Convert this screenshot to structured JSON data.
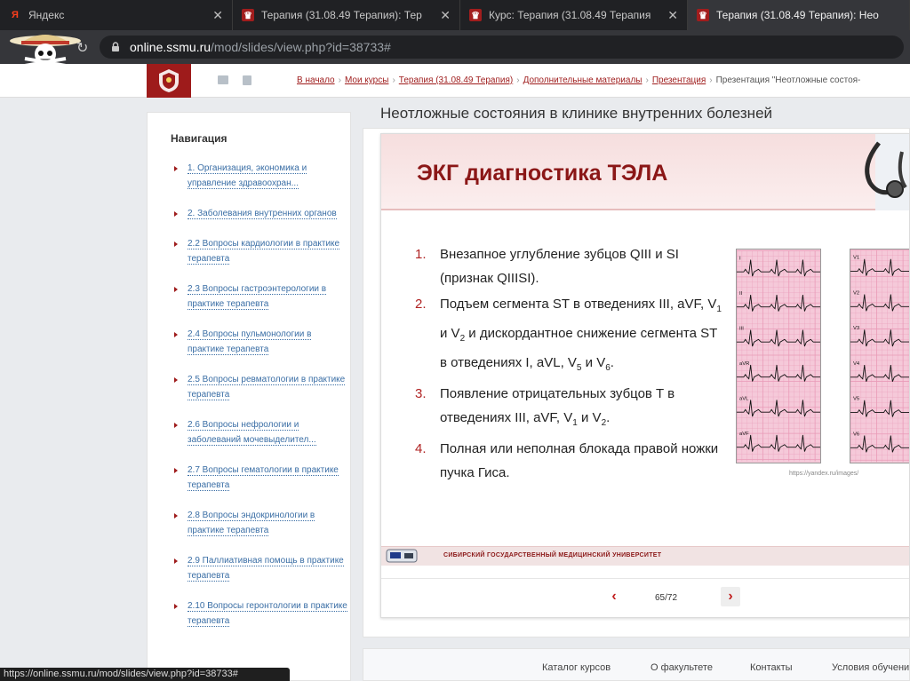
{
  "browser": {
    "tabs": [
      {
        "title": "Яндекс",
        "favicon": "yandex-icon"
      },
      {
        "title": "Терапия (31.08.49 Терапия): Тер",
        "favicon": "ssmu-crest-icon"
      },
      {
        "title": "Курс: Терапия (31.08.49 Терапия",
        "favicon": "ssmu-crest-icon"
      },
      {
        "title": "Терапия (31.08.49 Терапия): Нео",
        "favicon": "ssmu-crest-icon"
      }
    ],
    "url_host": "online.ssmu.ru",
    "url_path": "/mod/slides/view.php?id=38733#"
  },
  "header": {
    "breadcrumb": [
      {
        "label": "В начало",
        "link": true
      },
      {
        "label": "Мои курсы",
        "link": true
      },
      {
        "label": "Терапия (31.08.49 Терапия)",
        "link": true
      },
      {
        "label": "Дополнительные материалы",
        "link": true
      },
      {
        "label": "Презентация",
        "link": true
      },
      {
        "label": "Презентация \"Неотложные состоя-",
        "link": false
      }
    ]
  },
  "sidebar": {
    "heading": "Навигация",
    "items": [
      {
        "label": "1. Организация, экономика и управление здравоохран..."
      },
      {
        "label": "2. Заболевания внутренних органов"
      },
      {
        "label": "2.2 Вопросы кардиологии в практике терапевта"
      },
      {
        "label": "2.3 Вопросы гастроэнтерологии в практике терапевта"
      },
      {
        "label": "2.4 Вопросы пульмонологии в практике терапевта"
      },
      {
        "label": "2.5 Вопросы ревматологии в практике терапевта"
      },
      {
        "label": "2.6 Вопросы нефрологии и заболеваний мочевыделител..."
      },
      {
        "label": "2.7 Вопросы гематологии в практике терапевта"
      },
      {
        "label": "2.8 Вопросы эндокринологии в практике терапевта"
      },
      {
        "label": "2.9 Паллиативная помощь в практике терапевта"
      },
      {
        "label": "2.10 Вопросы геронтологии в практике терапевта"
      }
    ]
  },
  "main": {
    "title": "Неотложные состояния в клинике внутренних болезней",
    "slide": {
      "heading": "ЭКГ диагностика ТЭЛА",
      "items": [
        {
          "num": "1.",
          "text": "Внезапное углубление зубцов QIII и SI (признак QIIISI)."
        },
        {
          "num": "2.",
          "parts": [
            "Подъем сегмента ST в отведениях III, aVF, V",
            "1",
            " и V",
            "2",
            " и дискордантное снижение сегмента ST в отведениях I, aVL, V",
            "5",
            " и V",
            "6",
            "."
          ]
        },
        {
          "num": "3.",
          "parts": [
            "Появление отрицательных зубцов T в отведениях III, aVF, V",
            "1",
            " и V",
            "2",
            "."
          ]
        },
        {
          "num": "4.",
          "text": "Полная или неполная блокада правой ножки пучка Гиса."
        }
      ],
      "ecg_left_leads": [
        "I",
        "II",
        "III",
        "aVR",
        "aVL",
        "aVF"
      ],
      "ecg_right_leads": [
        "V1",
        "V2",
        "V3",
        "V4",
        "V5",
        "V6"
      ],
      "image_credit": "https://yandex.ru/images/",
      "university": "СИБИРСКИЙ ГОСУДАРСТВЕННЫЙ МЕДИЦИНСКИЙ УНИВЕРСИТЕТ"
    },
    "pager": {
      "prev": "‹",
      "next": "›",
      "counter": "65/72"
    }
  },
  "footer": {
    "links": [
      "Каталог курсов",
      "О факультете",
      "Контакты",
      "Условия обучени"
    ]
  },
  "status_url": "https://online.ssmu.ru/mod/slides/view.php?id=38733#",
  "colors": {
    "brand": "#9e1b1b",
    "link": "#3a6ea5",
    "slide_heading": "#8b1717",
    "ecg_paper": "#f5c9d9"
  }
}
